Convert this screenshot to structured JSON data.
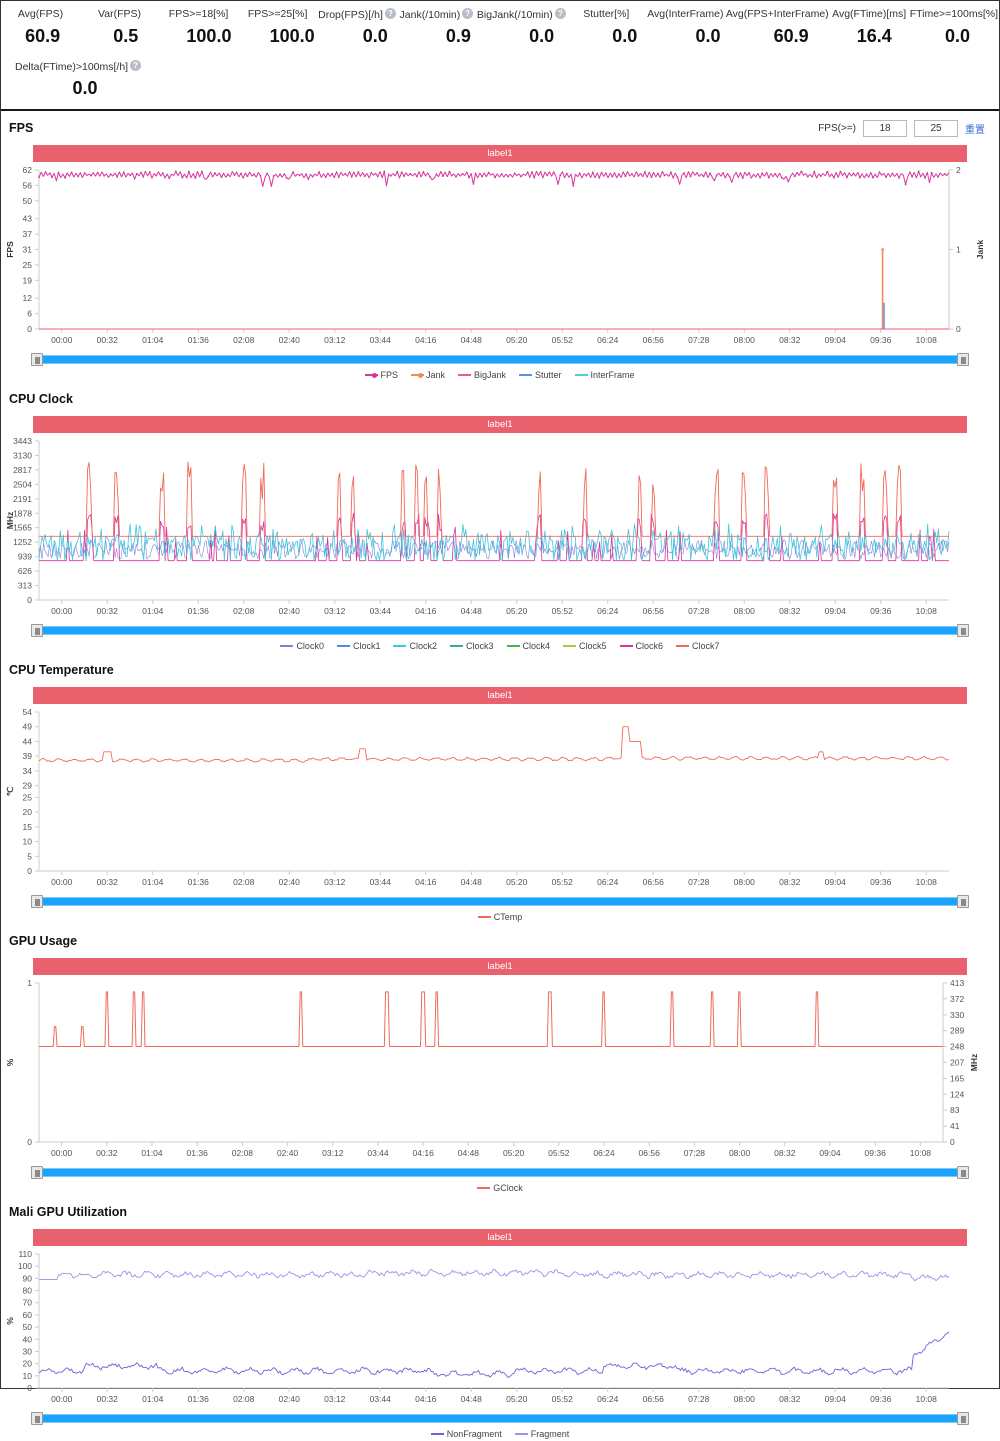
{
  "summary": {
    "metrics": [
      {
        "label": "Avg(FPS)",
        "value": "60.9",
        "help": false
      },
      {
        "label": "Var(FPS)",
        "value": "0.5",
        "help": false
      },
      {
        "label": "FPS>=18[%]",
        "value": "100.0",
        "help": false
      },
      {
        "label": "FPS>=25[%]",
        "value": "100.0",
        "help": false
      },
      {
        "label": "Drop(FPS)[/h]",
        "value": "0.0",
        "help": true
      },
      {
        "label": "Jank(/10min)",
        "value": "0.9",
        "help": true
      },
      {
        "label": "BigJank(/10min)",
        "value": "0.0",
        "help": true
      },
      {
        "label": "Stutter[%]",
        "value": "0.0",
        "help": false
      },
      {
        "label": "Avg(InterFrame)",
        "value": "0.0",
        "help": false
      },
      {
        "label": "Avg(FPS+InterFrame)",
        "value": "60.9",
        "help": false
      },
      {
        "label": "Avg(FTime)[ms]",
        "value": "16.4",
        "help": false
      },
      {
        "label": "FTime>=100ms[%]",
        "value": "0.0",
        "help": false
      }
    ],
    "secondary": [
      {
        "label": "Delta(FTime)>100ms[/h]",
        "value": "0.0",
        "help": true
      }
    ]
  },
  "fps_section": {
    "title": "FPS",
    "threshold_label": "FPS(>=)",
    "threshold_low": "18",
    "threshold_high": "25",
    "reset_link": "重置",
    "band_label": "label1"
  },
  "cpu_clock_section": {
    "title": "CPU Clock",
    "band_label": "label1"
  },
  "cpu_temp_section": {
    "title": "CPU Temperature",
    "band_label": "label1"
  },
  "gpu_usage_section": {
    "title": "GPU Usage",
    "band_label": "label1"
  },
  "mali_section": {
    "title": "Mali GPU Utilization",
    "band_label": "label1"
  },
  "time_ticks": [
    "00:00",
    "00:32",
    "01:04",
    "01:36",
    "02:08",
    "02:40",
    "03:12",
    "03:44",
    "04:16",
    "04:48",
    "05:20",
    "05:52",
    "06:24",
    "06:56",
    "07:28",
    "08:00",
    "08:32",
    "09:04",
    "09:36",
    "10:08"
  ],
  "chart_data": [
    {
      "type": "line",
      "title": "FPS",
      "xlabel": "",
      "ylabel": "FPS",
      "y2label": "Jank",
      "ylim": [
        0,
        62
      ],
      "y2lim": [
        0,
        2
      ],
      "yticks": [
        0,
        6,
        12,
        19,
        25,
        31,
        37,
        43,
        50,
        56,
        62
      ],
      "y2ticks": [
        0,
        1,
        2
      ],
      "xticks": [
        "00:00",
        "00:32",
        "01:04",
        "01:36",
        "02:08",
        "02:40",
        "03:12",
        "03:44",
        "04:16",
        "04:48",
        "05:20",
        "05:52",
        "06:24",
        "06:56",
        "07:28",
        "08:00",
        "08:32",
        "09:04",
        "09:36",
        "10:08"
      ],
      "grid": false,
      "legend_position": "bottom",
      "series": [
        {
          "name": "FPS",
          "color": "#d6359c",
          "axis": "left",
          "mean": 60.5,
          "min": 55,
          "max": 62,
          "note": "dense oscillation near 60 with occasional dips to 56-57"
        },
        {
          "name": "Jank",
          "color": "#f58b53",
          "axis": "right",
          "mean": 0,
          "spikes": [
            {
              "time": "09:28",
              "value": 1
            }
          ]
        },
        {
          "name": "BigJank",
          "color": "#e8616d",
          "axis": "right",
          "mean": 0
        },
        {
          "name": "Stutter",
          "color": "#5a8fe8",
          "axis": "right",
          "mean": 0,
          "spikes": [
            {
              "time": "09:28",
              "value": 0.35
            }
          ]
        },
        {
          "name": "InterFrame",
          "color": "#4fd0d8",
          "axis": "right",
          "mean": 0
        }
      ]
    },
    {
      "type": "line",
      "title": "CPU Clock",
      "ylabel": "MHz",
      "ylim": [
        0,
        3443
      ],
      "yticks": [
        0,
        313,
        626,
        939,
        1252,
        1565,
        1878,
        2191,
        2504,
        2817,
        3130,
        3443
      ],
      "xticks": [
        "00:00",
        "00:32",
        "01:04",
        "01:36",
        "02:08",
        "02:40",
        "03:12",
        "03:44",
        "04:16",
        "04:48",
        "05:20",
        "05:52",
        "06:24",
        "06:56",
        "07:28",
        "08:00",
        "08:32",
        "09:04",
        "09:36",
        "10:08"
      ],
      "grid": false,
      "legend_position": "bottom",
      "series": [
        {
          "name": "Clock0",
          "color": "#8b7fd4",
          "mean": 1100,
          "min": 850,
          "max": 1500
        },
        {
          "name": "Clock1",
          "color": "#4a90e2",
          "mean": 1100,
          "min": 850,
          "max": 1500
        },
        {
          "name": "Clock2",
          "color": "#3ec6e0",
          "mean": 1150,
          "min": 850,
          "max": 1650
        },
        {
          "name": "Clock3",
          "color": "#3aa8a0",
          "mean": 1150,
          "min": 850,
          "max": 1650
        },
        {
          "name": "Clock4",
          "color": "#4caf50",
          "mean": 900,
          "min": 850,
          "max": 1200
        },
        {
          "name": "Clock5",
          "color": "#a8c93a",
          "mean": 900,
          "min": 850,
          "max": 1200
        },
        {
          "name": "Clock6",
          "color": "#d6359c",
          "mean": 880,
          "min": 830,
          "max": 1900
        },
        {
          "name": "Clock7",
          "color": "#f06a5a",
          "mean": 1380,
          "min": 1350,
          "max": 3130,
          "note": "flat baseline ~1380 with tall narrow spikes to 2191-3130"
        }
      ]
    },
    {
      "type": "line",
      "title": "CPU Temperature",
      "ylabel": "℃",
      "ylim": [
        0,
        54
      ],
      "yticks": [
        0,
        5,
        10,
        15,
        20,
        25,
        29,
        34,
        39,
        44,
        49,
        54
      ],
      "xticks": [
        "00:00",
        "00:32",
        "01:04",
        "01:36",
        "02:08",
        "02:40",
        "03:12",
        "03:44",
        "04:16",
        "04:48",
        "05:20",
        "05:52",
        "06:24",
        "06:56",
        "07:28",
        "08:00",
        "08:32",
        "09:04",
        "09:36",
        "10:08"
      ],
      "grid": false,
      "legend_position": "bottom",
      "series": [
        {
          "name": "CTemp",
          "color": "#f06a5a",
          "mean": 38,
          "min": 36,
          "max": 49,
          "note": "steady near 37-39 with peak ~49 around 06:52"
        }
      ]
    },
    {
      "type": "line",
      "title": "GPU Usage",
      "ylabel": "%",
      "y2label": "MHz",
      "ylim": [
        0,
        1
      ],
      "y2lim": [
        0,
        413
      ],
      "yticks": [
        0,
        1
      ],
      "y2ticks": [
        0,
        41,
        83,
        124,
        165,
        207,
        248,
        289,
        330,
        372,
        413
      ],
      "xticks": [
        "00:00",
        "00:32",
        "01:04",
        "01:36",
        "02:08",
        "02:40",
        "03:12",
        "03:44",
        "04:16",
        "04:48",
        "05:20",
        "05:52",
        "06:24",
        "06:56",
        "07:28",
        "08:00",
        "08:32",
        "09:04",
        "09:36",
        "10:08"
      ],
      "grid": false,
      "legend_position": "bottom",
      "series": [
        {
          "name": "GClock",
          "color": "#f06a5a",
          "axis": "right",
          "mean": 248,
          "baseline": 248,
          "max": 390,
          "note": "flat at 248 MHz with ~14 narrow spikes to ~390 MHz"
        }
      ]
    },
    {
      "type": "line",
      "title": "Mali GPU Utilization",
      "ylabel": "%",
      "ylim": [
        0,
        110
      ],
      "yticks": [
        0,
        10,
        20,
        30,
        40,
        50,
        60,
        70,
        80,
        90,
        100,
        110
      ],
      "xticks": [
        "00:00",
        "00:32",
        "01:04",
        "01:36",
        "02:08",
        "02:40",
        "03:12",
        "03:44",
        "04:16",
        "04:48",
        "05:20",
        "05:52",
        "06:24",
        "06:56",
        "07:28",
        "08:00",
        "08:32",
        "09:04",
        "09:36",
        "10:08"
      ],
      "grid": false,
      "legend_position": "bottom",
      "series": [
        {
          "name": "NonFragment",
          "color": "#6c63d8",
          "mean": 14,
          "min": 9,
          "max": 38,
          "note": "low band 10-20% rising to ~38 at end"
        },
        {
          "name": "Fragment",
          "color": "#9a93e8",
          "mean": 93,
          "min": 88,
          "max": 100,
          "note": "high band 88-100%"
        }
      ]
    }
  ]
}
